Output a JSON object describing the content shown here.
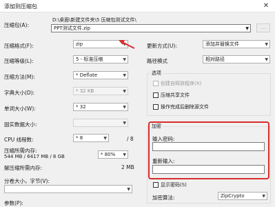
{
  "window": {
    "title": "添加到压缩包",
    "close_glyph": "✕"
  },
  "archive": {
    "label": "压缩包(A):",
    "path": "D:\\桌面\\新建文件夹\\5 压缩包测试文件\\",
    "filename": "PPT测试文件.zip",
    "browse_label": "..."
  },
  "left": {
    "format_label": "压缩格式(F):",
    "format_value": "zip",
    "level_label": "压缩等级(L):",
    "level_value": "5 - 标准压缩",
    "method_label": "压缩方法(M):",
    "method_value": "* Deflate",
    "dict_label": "字典大小(D):",
    "dict_value": "* 32 KB",
    "word_label": "单词大小(W):",
    "word_value": "* 32",
    "solid_label": "固实数据大小:",
    "solid_value": "",
    "cpu_label": "CPU 线程数:",
    "cpu_value": "* 8",
    "cpu_max": "/ 8",
    "mem_label": "压缩所需内存:",
    "mem_detail": "544 MB / 6417 MB / 8 GB",
    "mem_value": "* 80%",
    "decomp_label": "解压缩所需内存:",
    "decomp_value": "2 MB",
    "split_label": "分卷大小，字节(V):",
    "split_value": "",
    "params_label": "参数(P):"
  },
  "right": {
    "update_label": "更新方式(U):",
    "update_value": "添加并替换文件",
    "pathmode_label": "路径模式",
    "pathmode_value": "相对路径",
    "options_title": "选项",
    "opt_sfx": "创建自释放程序(X)",
    "opt_shared": "压缩共享文件",
    "opt_delete": "操作完成后删除源文件",
    "encrypt_title": "加密",
    "password_label": "输入密码:",
    "password_value": "",
    "reenter_label": "重新输入:",
    "reenter_value": "",
    "show_password_label": "显示密码(S)",
    "encrypt_method_label": "加密算法:",
    "encrypt_method_value": "ZipCrypto"
  },
  "colors": {
    "highlight": "#d92b2b"
  },
  "icons": {
    "dropdown": "chevron-down-icon",
    "close": "close-icon",
    "arrow": "red-arrow-annotation"
  }
}
